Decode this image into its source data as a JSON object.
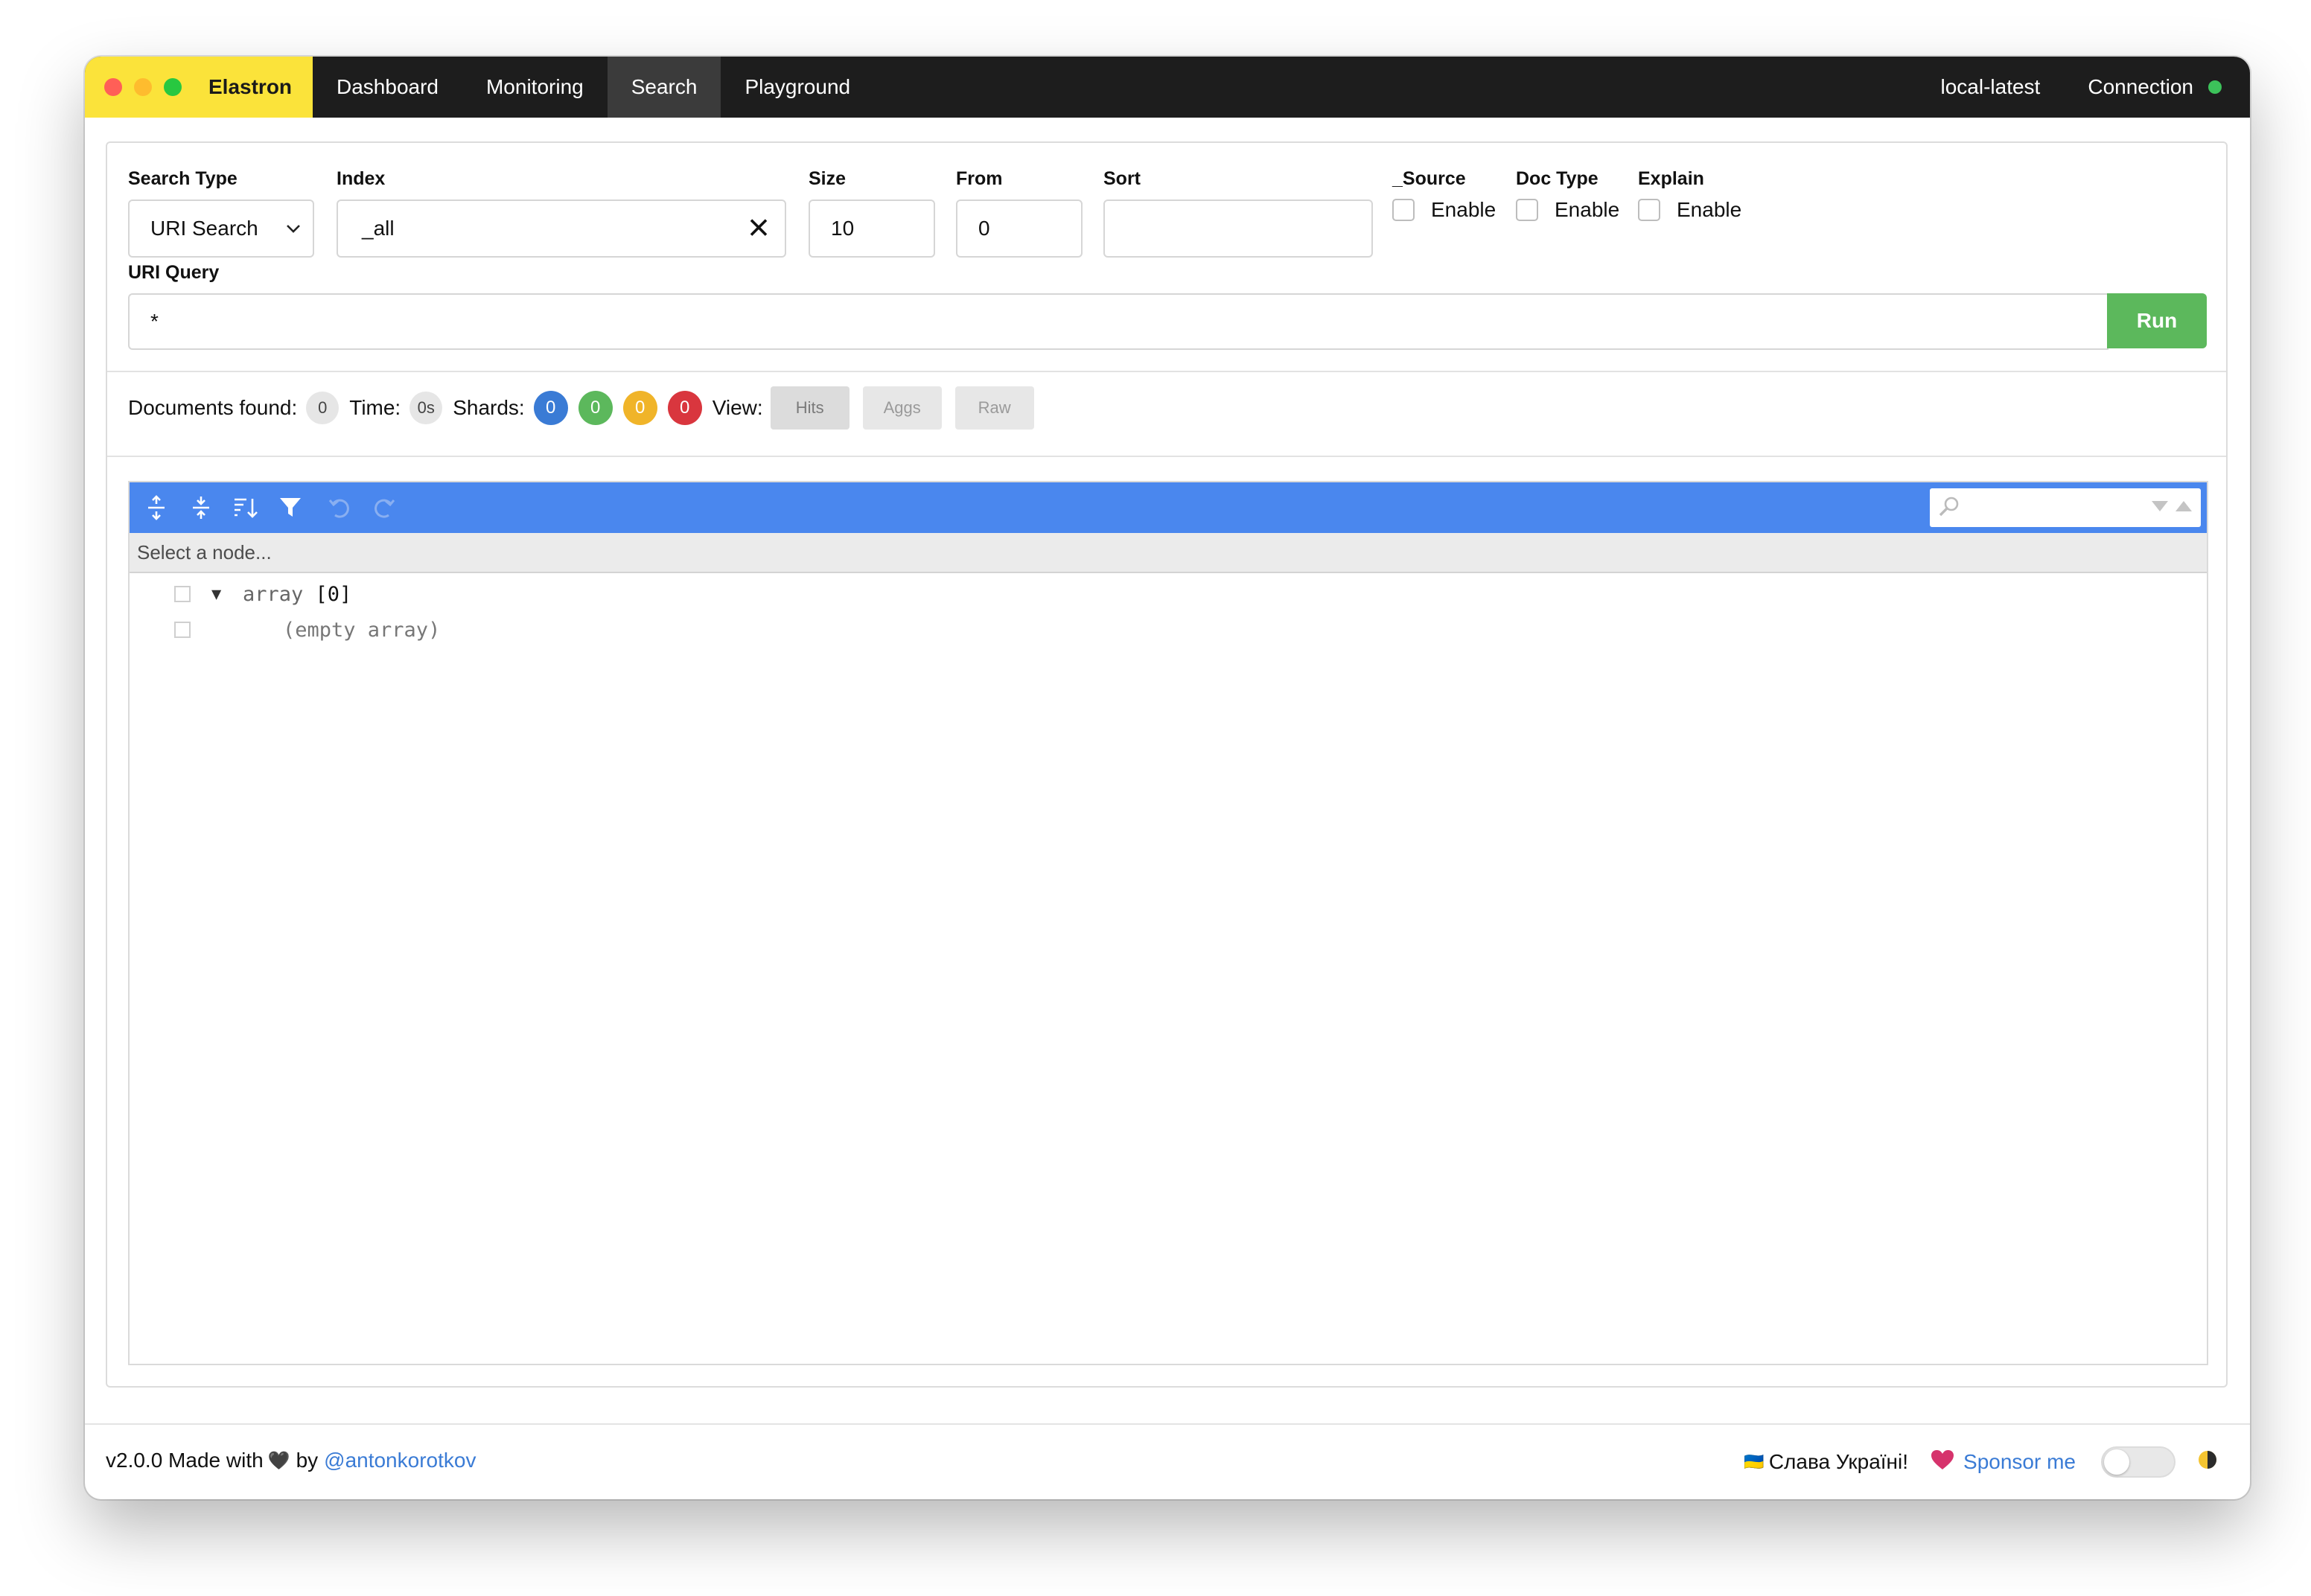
{
  "colors": {
    "brand_yellow": "#fbe33a",
    "navbar_bg": "#1d1d1d",
    "active_tab_bg": "#3b3b3b",
    "connection_ok": "#3cc25a",
    "run_green": "#5cb85c",
    "toolbar_blue": "#4a87ee",
    "shard_total": "#3a7bd5",
    "shard_success": "#5cb85c",
    "shard_skipped": "#f0b429",
    "shard_failed": "#d9363e",
    "link_blue": "#3a7bd5",
    "heart_pink": "#d6336c",
    "traffic_red": "#ff5f57",
    "traffic_yellow": "#febc2e",
    "traffic_green": "#28c840"
  },
  "navbar": {
    "brand": "Elastron",
    "tabs": [
      {
        "label": "Dashboard",
        "active": false
      },
      {
        "label": "Monitoring",
        "active": false
      },
      {
        "label": "Search",
        "active": true
      },
      {
        "label": "Playground",
        "active": false
      }
    ],
    "cluster": "local-latest",
    "connection_label": "Connection"
  },
  "form": {
    "search_type": {
      "label": "Search Type",
      "value": "URI Search"
    },
    "index": {
      "label": "Index",
      "value": "_all"
    },
    "size": {
      "label": "Size",
      "value": "10"
    },
    "from": {
      "label": "From",
      "value": "0"
    },
    "sort": {
      "label": "Sort",
      "value": ""
    },
    "source": {
      "label": "_Source",
      "option": "Enable",
      "checked": false
    },
    "doc_type": {
      "label": "Doc Type",
      "option": "Enable",
      "checked": false
    },
    "explain": {
      "label": "Explain",
      "option": "Enable",
      "checked": false
    },
    "uri_query": {
      "label": "URI Query",
      "value": "*"
    },
    "run_label": "Run"
  },
  "stats": {
    "documents_label": "Documents found:",
    "documents": "0",
    "time_label": "Time:",
    "time": "0s",
    "shards_label": "Shards:",
    "shards": [
      "0",
      "0",
      "0",
      "0"
    ],
    "view_label": "View:",
    "views": [
      "Hits",
      "Aggs",
      "Raw"
    ]
  },
  "editor": {
    "nav_placeholder": "Select a node...",
    "root_key": "array",
    "root_count": "[0]",
    "empty_text": "(empty array)",
    "toolbar_icons": [
      "expand-all-icon",
      "collapse-all-icon",
      "sort-icon",
      "filter-icon",
      "undo-icon",
      "redo-icon"
    ]
  },
  "footer": {
    "version_text": "v2.0.0 Made with",
    "heart": "🖤",
    "by_text": "by",
    "author": "@antonkorotkov",
    "ukraine_flag": "🇺🇦",
    "ukraine_text": "Слава Україні!",
    "sponsor_heart": "💗",
    "sponsor_text": "Sponsor me"
  }
}
